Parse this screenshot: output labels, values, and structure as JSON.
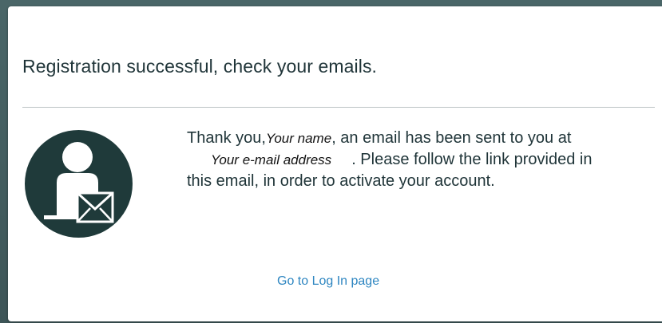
{
  "dialog": {
    "title": "Registration successful, check your emails.",
    "message": {
      "part1": "Thank you,",
      "name_placeholder": "Your name",
      "part2": ", an email has been sent to you at",
      "email_placeholder": "Your e-mail address",
      "part3": ". Please follow the link provided in this email, in order to activate your account."
    },
    "login_link": "Go to Log In page",
    "icon": "user-email-icon"
  },
  "colors": {
    "backdrop": "#3f5a5c",
    "icon_fill": "#1f3a3a",
    "link": "#2e86c1",
    "text": "#1f3438"
  }
}
